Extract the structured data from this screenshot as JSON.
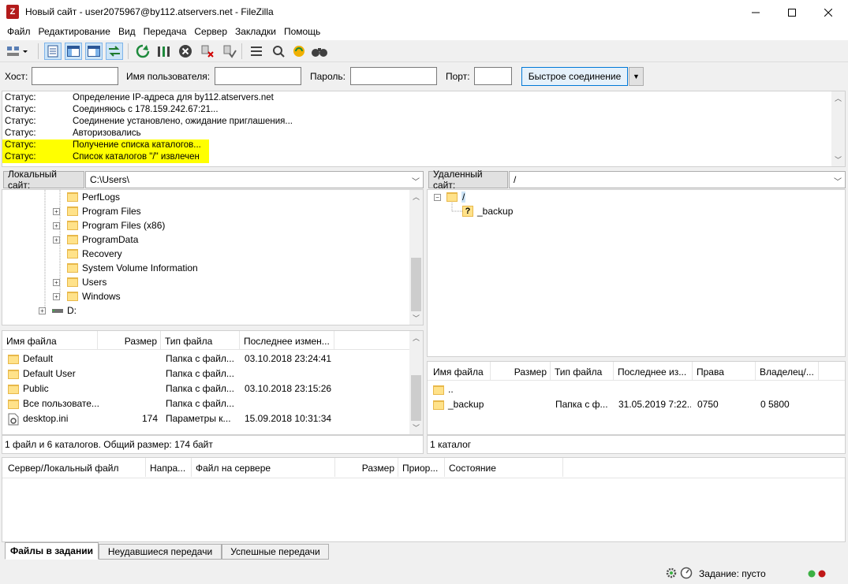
{
  "window": {
    "title": "Новый сайт - user2075967@by112.atservers.net - FileZilla",
    "app_icon": "Z"
  },
  "menu": [
    "Файл",
    "Редактирование",
    "Вид",
    "Передача",
    "Сервер",
    "Закладки",
    "Помощь"
  ],
  "quickconnect": {
    "host_label": "Хост:",
    "user_label": "Имя пользователя:",
    "pass_label": "Пароль:",
    "port_label": "Порт:",
    "host_value": "",
    "user_value": "",
    "pass_value": "",
    "port_value": "",
    "connect_button": "Быстрое соединение"
  },
  "log": [
    {
      "label": "Статус:",
      "message": "Определение IP-адреса для by112.atservers.net",
      "highlight": false
    },
    {
      "label": "Статус:",
      "message": "Соединяюсь с 178.159.242.67:21...",
      "highlight": false
    },
    {
      "label": "Статус:",
      "message": "Соединение установлено, ожидание приглашения...",
      "highlight": false
    },
    {
      "label": "Статус:",
      "message": "Авторизовались",
      "highlight": false
    },
    {
      "label": "Статус:",
      "message": "Получение списка каталогов...",
      "highlight": true
    },
    {
      "label": "Статус:",
      "message": "Список каталогов \"/\" извлечен",
      "highlight": true
    }
  ],
  "local": {
    "site_label": "Локальный сайт:",
    "path": "C:\\Users\\",
    "tree": [
      {
        "name": "PerfLogs",
        "expandable": false
      },
      {
        "name": "Program Files",
        "expandable": true
      },
      {
        "name": "Program Files (x86)",
        "expandable": true
      },
      {
        "name": "ProgramData",
        "expandable": true
      },
      {
        "name": "Recovery",
        "expandable": false
      },
      {
        "name": "System Volume Information",
        "expandable": false
      },
      {
        "name": "Users",
        "expandable": true
      },
      {
        "name": "Windows",
        "expandable": true
      }
    ],
    "drive": "D:",
    "columns": [
      "Имя файла",
      "Размер",
      "Тип файла",
      "Последнее измен..."
    ],
    "files": [
      {
        "name": "Default",
        "size": "",
        "type": "Папка с файл...",
        "modified": "03.10.2018 23:24:41",
        "kind": "folder"
      },
      {
        "name": "Default User",
        "size": "",
        "type": "Папка с файл...",
        "modified": "",
        "kind": "folder"
      },
      {
        "name": "Public",
        "size": "",
        "type": "Папка с файл...",
        "modified": "03.10.2018 23:15:26",
        "kind": "folder"
      },
      {
        "name": "Все пользовате...",
        "size": "",
        "type": "Папка с файл...",
        "modified": "",
        "kind": "folder"
      },
      {
        "name": "desktop.ini",
        "size": "174",
        "type": "Параметры к...",
        "modified": "15.09.2018 10:31:34",
        "kind": "file"
      }
    ],
    "status": "1 файл и 6 каталогов. Общий размер: 174 байт"
  },
  "remote": {
    "site_label": "Удаленный сайт:",
    "path": "/",
    "tree_root": "/",
    "tree_child": "_backup",
    "columns": [
      "Имя файла",
      "Размер",
      "Тип файла",
      "Последнее из...",
      "Права",
      "Владелец/..."
    ],
    "files": [
      {
        "name": "..",
        "size": "",
        "type": "",
        "modified": "",
        "perms": "",
        "owner": ""
      },
      {
        "name": "_backup",
        "size": "",
        "type": "Папка с ф...",
        "modified": "31.05.2019 7:22...",
        "perms": "0750",
        "owner": "0 5800"
      }
    ],
    "status": "1 каталог"
  },
  "queue": {
    "columns": [
      "Сервер/Локальный файл",
      "Напра...",
      "Файл на сервере",
      "Размер",
      "Приор...",
      "Состояние"
    ]
  },
  "tabs": [
    "Файлы в задании",
    "Неудавшиеся передачи",
    "Успешные передачи"
  ],
  "statusbar": {
    "queue_text": "Задание: пусто"
  },
  "colors": {
    "highlight": "#ffff00",
    "accent": "#0078d7"
  }
}
